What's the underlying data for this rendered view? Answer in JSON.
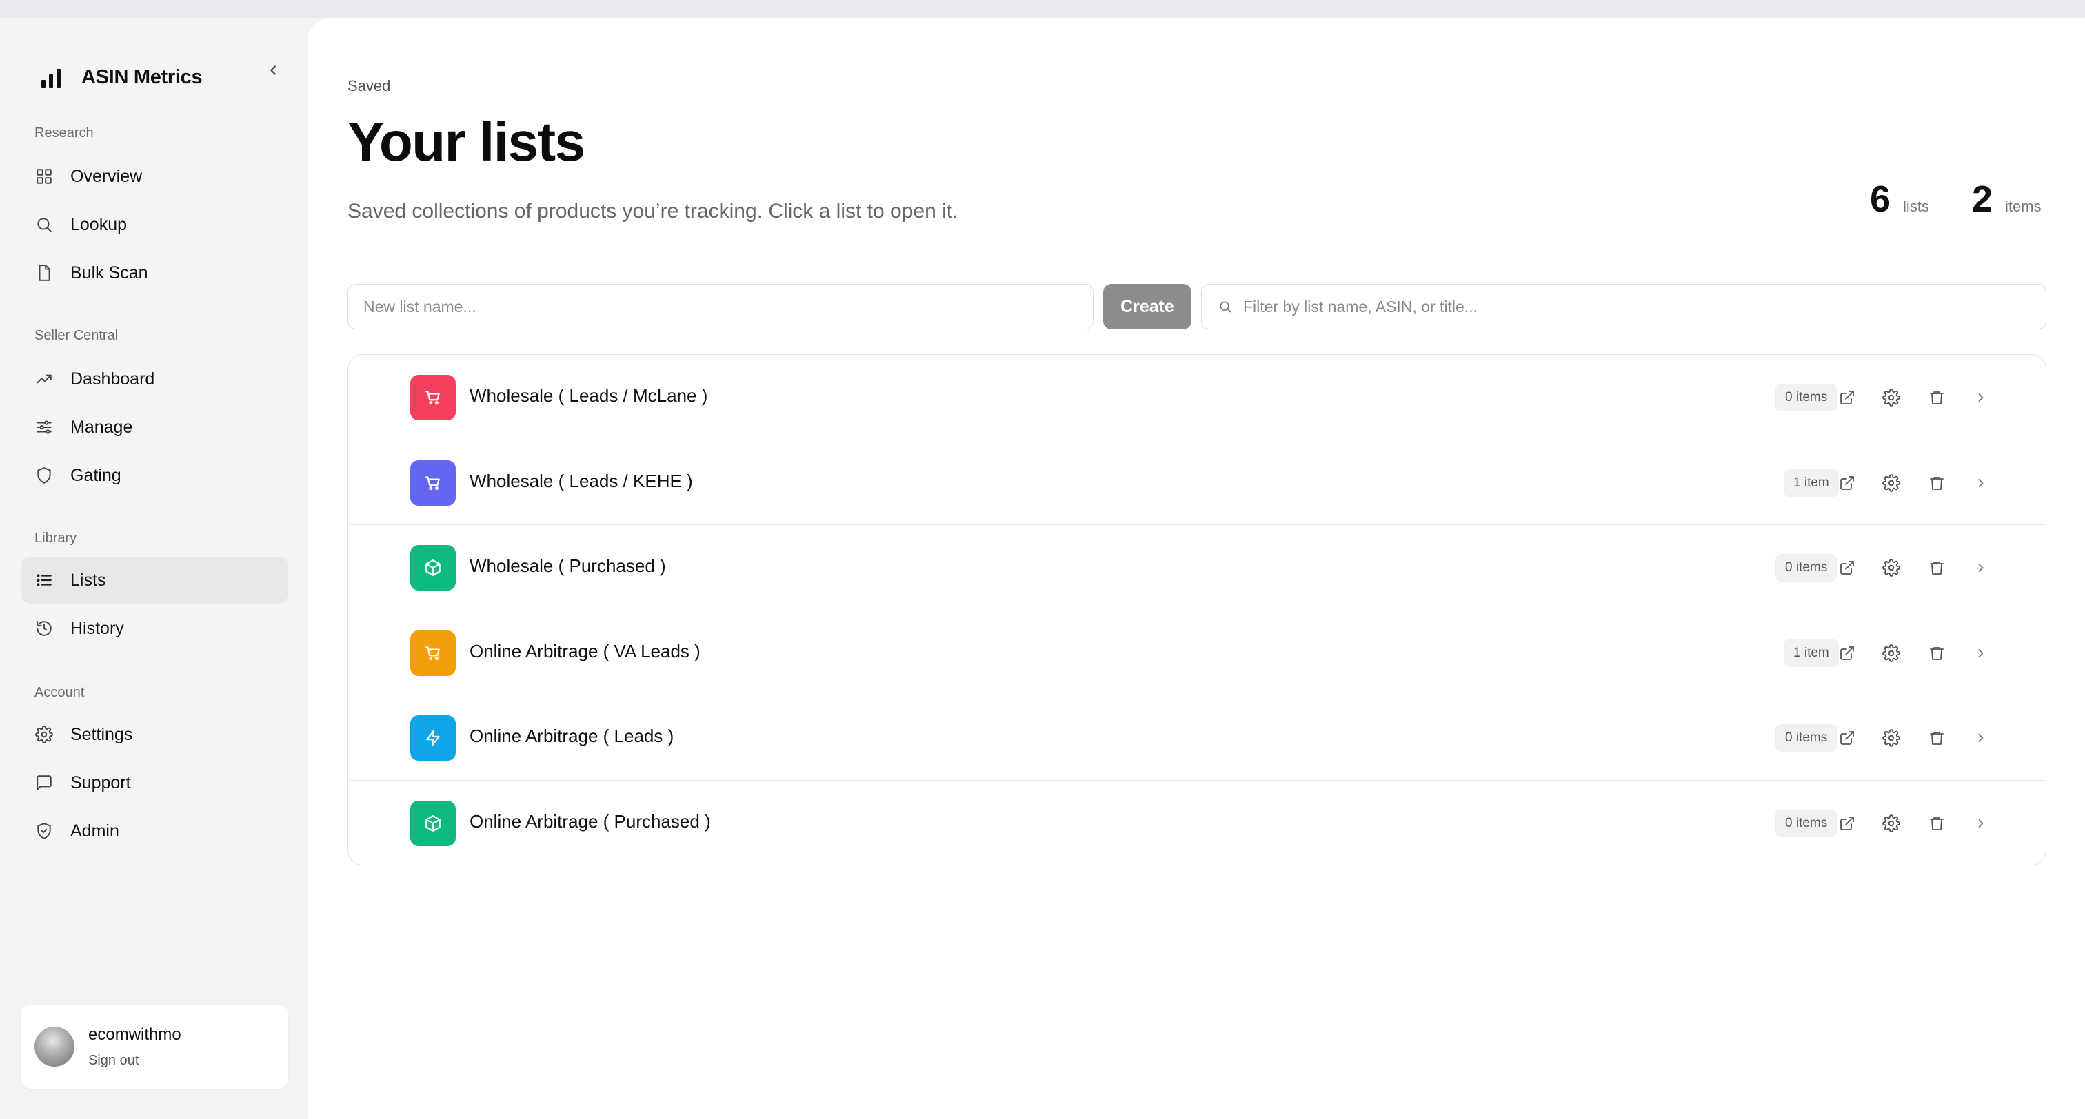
{
  "app": {
    "name": "ASIN Metrics"
  },
  "sidebar": {
    "sections": [
      {
        "label": "Research",
        "items": [
          {
            "label": "Overview",
            "icon": "grid-icon"
          },
          {
            "label": "Lookup",
            "icon": "search-icon"
          },
          {
            "label": "Bulk Scan",
            "icon": "file-icon"
          }
        ]
      },
      {
        "label": "Seller Central",
        "items": [
          {
            "label": "Dashboard",
            "icon": "trending-up-icon"
          },
          {
            "label": "Manage",
            "icon": "sliders-icon"
          },
          {
            "label": "Gating",
            "icon": "shield-icon"
          }
        ]
      },
      {
        "label": "Library",
        "items": [
          {
            "label": "Lists",
            "icon": "list-icon",
            "active": true
          },
          {
            "label": "History",
            "icon": "history-icon"
          }
        ]
      },
      {
        "label": "Account",
        "items": [
          {
            "label": "Settings",
            "icon": "gear-icon"
          },
          {
            "label": "Support",
            "icon": "message-icon"
          },
          {
            "label": "Admin",
            "icon": "shield-check-icon"
          }
        ]
      }
    ],
    "user": {
      "name": "ecomwithmo",
      "signout_label": "Sign out"
    }
  },
  "main": {
    "breadcrumb": "Saved",
    "title": "Your lists",
    "subtitle": "Saved collections of products you’re tracking. Click a list to open it.",
    "stats": {
      "lists_count": "6",
      "lists_label": "lists",
      "items_count": "2",
      "items_label": "items"
    },
    "new_list": {
      "placeholder": "New list name...",
      "create_label": "Create"
    },
    "filter": {
      "placeholder": "Filter by list name, ASIN, or title..."
    },
    "lists": [
      {
        "name": "Wholesale ( Leads / McLane )",
        "count": "0 items",
        "color": "#f43f5e",
        "icon": "cart-icon"
      },
      {
        "name": "Wholesale ( Leads / KEHE )",
        "count": "1 item",
        "color": "#6366f1",
        "icon": "cart-icon"
      },
      {
        "name": "Wholesale ( Purchased )",
        "count": "0 items",
        "color": "#10b981",
        "icon": "box-icon"
      },
      {
        "name": "Online Arbitrage ( VA Leads )",
        "count": "1 item",
        "color": "#f59e0b",
        "icon": "cart-icon"
      },
      {
        "name": "Online Arbitrage ( Leads )",
        "count": "0 items",
        "color": "#0ea5e9",
        "icon": "bolt-icon"
      },
      {
        "name": "Online Arbitrage ( Purchased )",
        "count": "0 items",
        "color": "#10b981",
        "icon": "box-icon"
      }
    ]
  },
  "colors": {
    "sidebar_bg": "#f4f4f5",
    "active_item_bg": "#e8e8ea",
    "create_button_bg": "#8c8c8c",
    "badge_bg": "#f1f1f2"
  }
}
